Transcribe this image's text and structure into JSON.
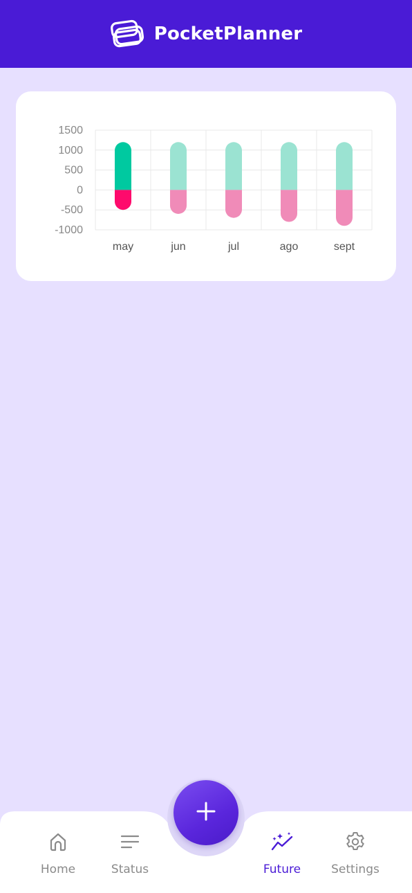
{
  "app": {
    "name": "PocketPlanner"
  },
  "colors": {
    "header": "#4a1bd6",
    "background": "#e7e0ff",
    "income_current": "#00c9a0",
    "income_future": "#9be3d2",
    "expense_current": "#fe0a6c",
    "expense_future": "#f08bb8",
    "nav_active": "#4a1bd6",
    "nav_inactive": "#8a8a8a"
  },
  "chart_data": {
    "type": "bar",
    "categories": [
      "may",
      "jun",
      "jul",
      "ago",
      "sept"
    ],
    "series": [
      {
        "values": [
          1200,
          1200,
          1200,
          1200,
          1200
        ]
      },
      {
        "values": [
          -500,
          -600,
          -700,
          -800,
          -900
        ]
      }
    ],
    "y_ticks": [
      "1500",
      "1000",
      "500",
      "0",
      "-500",
      "-1000"
    ],
    "ylim": [
      -1000,
      1500
    ],
    "grid": true
  },
  "fab": {
    "icon": "plus-icon"
  },
  "nav": {
    "items": [
      {
        "label": "Home",
        "icon": "home-icon",
        "active": false
      },
      {
        "label": "Status",
        "icon": "list-lines-icon",
        "active": false
      },
      {
        "label": "Future",
        "icon": "sparkle-trend-icon",
        "active": true
      },
      {
        "label": "Settings",
        "icon": "gear-icon",
        "active": false
      }
    ]
  }
}
